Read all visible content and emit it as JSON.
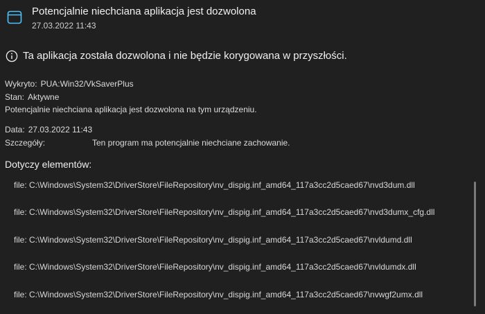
{
  "header": {
    "icon": "app-window-icon",
    "title": "Potencjalnie niechciana aplikacja jest dozwolona",
    "date": "27.03.2022 11:43"
  },
  "info": {
    "icon": "info-circle-icon",
    "text": "Ta aplikacja została dozwolona i nie będzie korygowana w przyszłości."
  },
  "details": {
    "detected_label": "Wykryto:",
    "detected_value": "PUA:Win32/VkSaverPlus",
    "status_label": "Stan:",
    "status_value": "Aktywne",
    "description": "Potencjalnie niechciana aplikacja jest dozwolona na tym urządzeniu.",
    "date_label": "Data:",
    "date_value": "27.03.2022 11:43",
    "details_label": "Szczegóły:",
    "details_value": "Ten program ma potencjalnie niechciane zachowanie."
  },
  "affected": {
    "title": "Dotyczy elementów:",
    "items": [
      "file: C:\\Windows\\System32\\DriverStore\\FileRepository\\nv_dispig.inf_amd64_117a3cc2d5caed67\\nvd3dum.dll",
      "file: C:\\Windows\\System32\\DriverStore\\FileRepository\\nv_dispig.inf_amd64_117a3cc2d5caed67\\nvd3dumx_cfg.dll",
      "file: C:\\Windows\\System32\\DriverStore\\FileRepository\\nv_dispig.inf_amd64_117a3cc2d5caed67\\nvldumd.dll",
      "file: C:\\Windows\\System32\\DriverStore\\FileRepository\\nv_dispig.inf_amd64_117a3cc2d5caed67\\nvldumdx.dll",
      "file: C:\\Windows\\System32\\DriverStore\\FileRepository\\nv_dispig.inf_amd64_117a3cc2d5caed67\\nvwgf2umx.dll"
    ]
  },
  "colors": {
    "background": "#202020",
    "accent": "#4cc2ff",
    "text": "#e6e6e6"
  }
}
